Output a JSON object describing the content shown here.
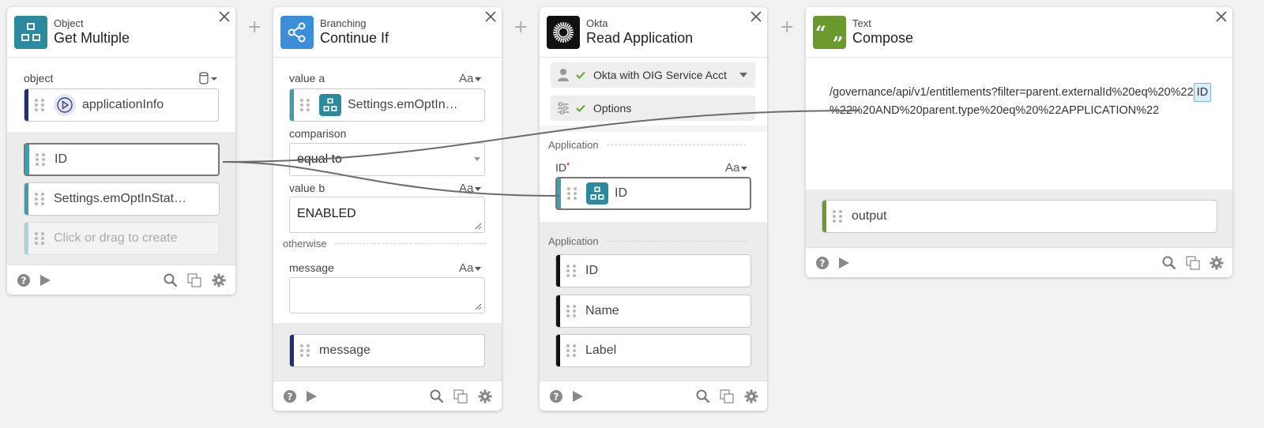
{
  "cards": {
    "c1": {
      "category": "Object",
      "title": "Get Multiple",
      "field_label": "object",
      "input_value": "applicationInfo",
      "outputs": [
        "ID",
        "Settings.emOptInStat…"
      ],
      "create_placeholder": "Click or drag to create"
    },
    "c2": {
      "category": "Branching",
      "title": "Continue If",
      "value_a_label": "value a",
      "value_a": "Settings.emOptIn…",
      "comparison_label": "comparison",
      "comparison_value": "equal to",
      "value_b_label": "value b",
      "value_b": "ENABLED",
      "otherwise_label": "otherwise",
      "message_label": "message",
      "message_value": "",
      "output": "message"
    },
    "c3": {
      "category": "Okta",
      "title": "Read Application",
      "connection": "Okta with OIG Service Acct",
      "options": "Options",
      "input_section": "Application",
      "id_label": "ID",
      "required_mark": "*",
      "id_input": "ID",
      "output_section": "Application",
      "outputs": [
        "ID",
        "Name",
        "Label"
      ]
    },
    "c4": {
      "category": "Text",
      "title": "Compose",
      "text_before": "/governance/api/v1/entitlements?filter=parent.externalId%20eq%20%22",
      "token": "ID",
      "text_after": "%22%20AND%20parent.type%20eq%20%22APPLICATION%22",
      "output": "output"
    }
  },
  "common": {
    "aa_label": "Aa",
    "plus": "+"
  },
  "colors": {
    "object_icon": "#2b8a9e",
    "branching_icon": "#3a8fd8",
    "okta_icon": "#111111",
    "text_icon": "#6a9a2e",
    "bar_navy": "#1d2f7a",
    "bar_teal": "#3aa0b0",
    "bar_black": "#111111",
    "bar_green": "#6a9a2e",
    "check_green": "#5aa830"
  }
}
